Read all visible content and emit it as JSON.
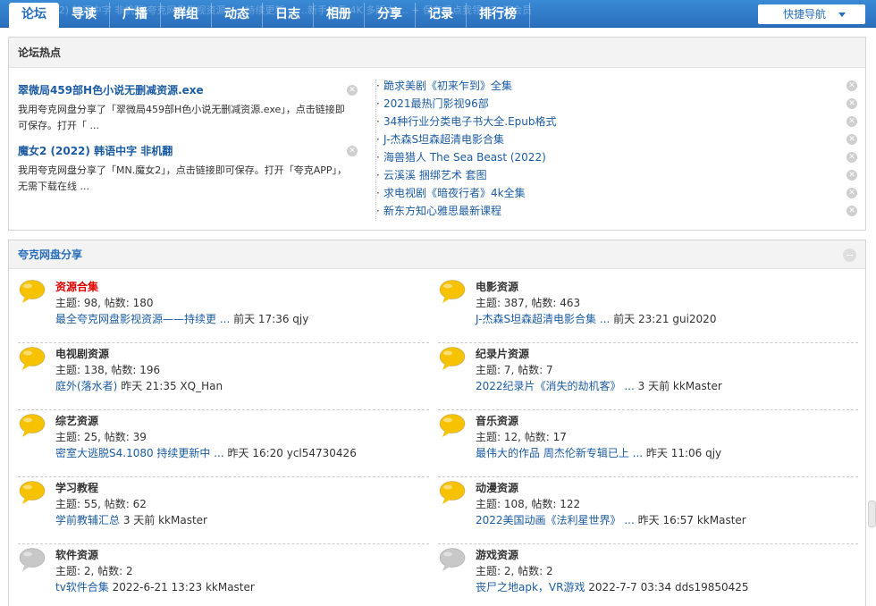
{
  "nav": {
    "ghost_text": "2 (2022) 韩语中字 非机翻     夸克网盘影视资源——持续更新     ……新手必看     4K 多版本 …   + 保存后点我领❤30天会员",
    "tabs": [
      "论坛",
      "导读",
      "广播",
      "群组",
      "动态",
      "日志",
      "相册",
      "分享",
      "记录",
      "排行榜"
    ],
    "quicknav_label": "快捷导航"
  },
  "hot": {
    "title": "论坛热点",
    "featured": [
      {
        "title": "翠微局459部H色小说无删减资源.exe",
        "desc": "我用夸克网盘分享了「翠微局459部H色小说无删减资源.exe」，点击链接即可保存。打开「 ..."
      },
      {
        "title": "魔女2 (2022) 韩语中字 非机翻",
        "desc": "我用夸克网盘分享了「MN.魔女2」，点击链接即可保存。打开「夸克APP」，无需下载在线 ..."
      }
    ],
    "list": [
      "跪求美剧《初来乍到》全集",
      "2021最热门影视96部",
      "34种行业分类电子书大全.Epub格式",
      "J-杰森S坦森超清电影合集",
      "海兽猎人 The Sea Beast (2022)",
      "云溪溪 捆绑艺术 套图",
      "求电视剧《暗夜行者》4k全集",
      "新东方知心雅思最新课程"
    ],
    "close_glyph": "✕"
  },
  "forum": {
    "title": "夸克网盘分享",
    "boards": [
      {
        "name": "资源合集",
        "red": true,
        "stats": "主题: 98, 帖数: 180",
        "last_link": "最全夸克网盘影视资源——持续更 ...",
        "last_meta": " 前天 17:36 qjy",
        "icon_color": "#f7c200"
      },
      {
        "name": "电影资源",
        "red": false,
        "stats": "主题: 387, 帖数: 463",
        "last_link": "J-杰森S坦森超清电影合集 ...",
        "last_meta": " 前天 23:21 gui2020",
        "icon_color": "#f7c200"
      },
      {
        "name": "电视剧资源",
        "red": false,
        "stats": "主题: 138, 帖数: 196",
        "last_link": "庭外(落水者)",
        "last_meta": " 昨天 21:35 XQ_Han",
        "icon_color": "#f7c200"
      },
      {
        "name": "纪录片资源",
        "red": false,
        "stats": "主题: 7, 帖数: 7",
        "last_link": "2022纪录片《消失的劫机客》 ...",
        "last_meta": " 3 天前 kkMaster",
        "icon_color": "#f7c200"
      },
      {
        "name": "综艺资源",
        "red": false,
        "stats": "主题: 25, 帖数: 39",
        "last_link": "密室大逃脱S4.1080 持续更新中 ...",
        "last_meta": " 昨天 16:20 ycl54730426",
        "icon_color": "#f7c200"
      },
      {
        "name": "音乐资源",
        "red": false,
        "stats": "主题: 12, 帖数: 17",
        "last_link": "最伟大的作品 周杰伦新专辑已上 ...",
        "last_meta": " 昨天 11:06 qjy",
        "icon_color": "#f7c200"
      },
      {
        "name": "学习教程",
        "red": false,
        "stats": "主题: 55, 帖数: 62",
        "last_link": "学前教辅汇总",
        "last_meta": " 3 天前 kkMaster",
        "icon_color": "#f7c200"
      },
      {
        "name": "动漫资源",
        "red": false,
        "stats": "主题: 108, 帖数: 122",
        "last_link": "2022美国动画《法利星世界》 ...",
        "last_meta": " 昨天 16:57 kkMaster",
        "icon_color": "#f7c200"
      },
      {
        "name": "软件资源",
        "red": false,
        "stats": "主题: 2, 帖数: 2",
        "last_link": "tv软件合集",
        "last_meta": " 2022-6-21 13:23 kkMaster",
        "icon_color": "#c8c8c8"
      },
      {
        "name": "游戏资源",
        "red": false,
        "stats": "主题: 2, 帖数: 2",
        "last_link": "丧尸之地apk，VR游戏",
        "last_meta": " 2022-7-7 03:34 dds19850425",
        "icon_color": "#c8c8c8"
      }
    ]
  }
}
